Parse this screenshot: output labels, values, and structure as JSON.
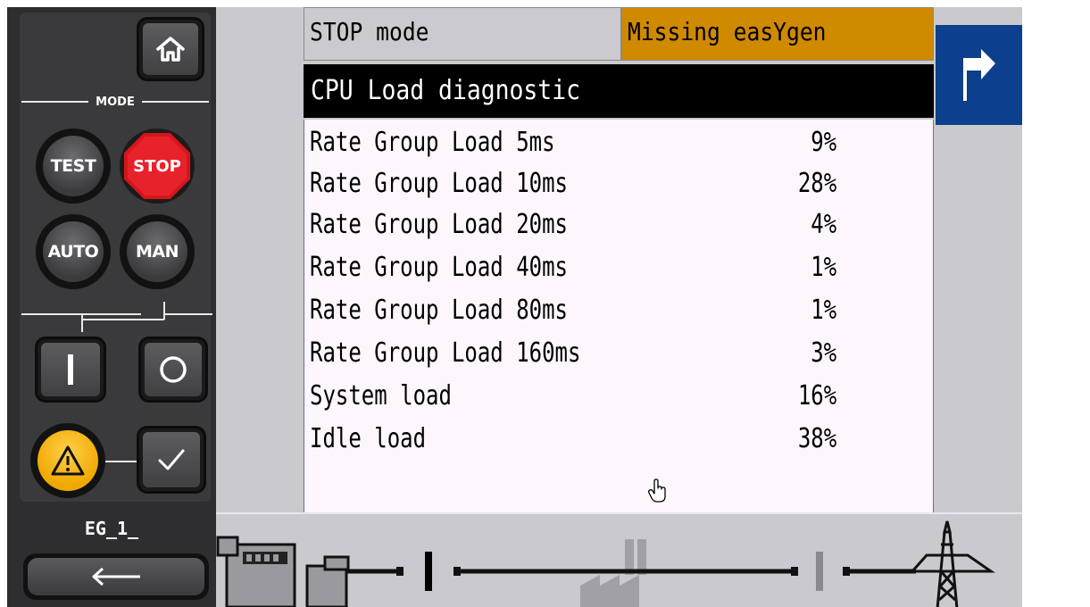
{
  "panel": {
    "mode_label": "MODE",
    "buttons": {
      "test": "TEST",
      "stop": "STOP",
      "auto": "AUTO",
      "man": "MAN"
    },
    "device_name": "EG_1_"
  },
  "header": {
    "mode_status": "STOP mode",
    "alarm_status": "Missing easYgen",
    "alarm_color": "#d08a00"
  },
  "screen": {
    "title": "CPU Load diagnostic",
    "rows": [
      {
        "label": "Rate Group Load 5ms",
        "value": "9%"
      },
      {
        "label": "Rate Group Load 10ms",
        "value": "28%"
      },
      {
        "label": "Rate Group Load 20ms",
        "value": "4%"
      },
      {
        "label": "Rate Group Load 40ms",
        "value": "1%"
      },
      {
        "label": "Rate Group Load 80ms",
        "value": "1%"
      },
      {
        "label": "Rate Group Load 160ms",
        "value": "3%"
      },
      {
        "label": "System load",
        "value": "16%"
      },
      {
        "label": "Idle load",
        "value": "38%"
      }
    ]
  },
  "icons": {
    "home": "home-icon",
    "on": "breaker-on-icon",
    "off": "breaker-off-icon",
    "alarm": "warning-icon",
    "acknowledge": "check-icon",
    "back": "arrow-left-icon",
    "nav": "turn-right-arrow-icon"
  }
}
